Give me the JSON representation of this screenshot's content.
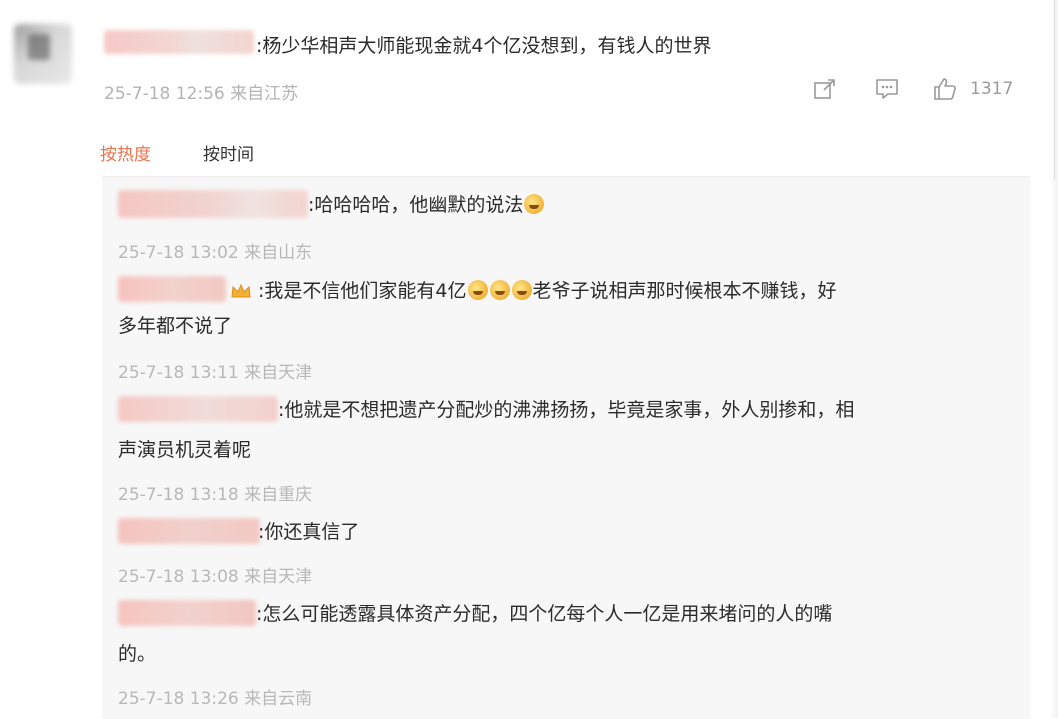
{
  "colors": {
    "accent": "#eb7350",
    "meta_text": "#b3b3b3",
    "reply_background": "#f7f7f7"
  },
  "main_comment": {
    "text": ":杨少华相声大师能现金就4个亿没想到，有钱人的世界",
    "meta": "25-7-18 12:56 来自江苏",
    "actions": {
      "share_icon": "share-icon",
      "comment_icon": "comment-icon",
      "like_icon": "like-icon",
      "like_count": "1317"
    }
  },
  "sort_tabs": {
    "hot": "按热度",
    "time": "按时间"
  },
  "replies": [
    {
      "segments": [
        ":哈哈哈哈，他幽默的说法"
      ],
      "emoji_count": 1,
      "meta": "25-7-18 13:02 来自山东"
    },
    {
      "badge_icon": "crown-icon",
      "segments": [
        ":我是不信他们家能有4亿",
        "老爷子说相声那时候根本不赚钱，好"
      ],
      "line2": "多年都不说了",
      "meta": "25-7-18 13:11 来自天津"
    },
    {
      "line1": ":他就是不想把遗产分配炒的沸沸扬扬，毕竟是家事，外人别掺和，相",
      "line2": "声演员机灵着呢",
      "meta": "25-7-18 13:18 来自重庆"
    },
    {
      "line1": ":你还真信了",
      "meta": "25-7-18 13:08 来自天津"
    },
    {
      "line1": ":怎么可能透露具体资产分配，四个亿每个人一亿是用来堵问的人的嘴",
      "line2": "的。",
      "meta": "25-7-18 13:26 来自云南"
    }
  ]
}
